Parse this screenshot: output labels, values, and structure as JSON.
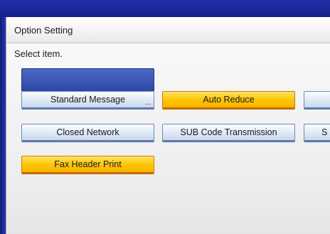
{
  "window": {
    "title": "Option Setting",
    "prompt": "Select item."
  },
  "buttons": {
    "standard_message": "Standard Message",
    "standard_message_more": "...",
    "auto_reduce": "Auto Reduce",
    "closed_network": "Closed Network",
    "sub_code_transmission": "SUB Code Transmission",
    "clipped_right_row2": "S",
    "fax_header_print": "Fax Header Print"
  },
  "colors": {
    "frame": "#1a2a8a",
    "selected": "#ffc400",
    "unselected": "#dce7f4",
    "header_block": "#3a55b4"
  }
}
